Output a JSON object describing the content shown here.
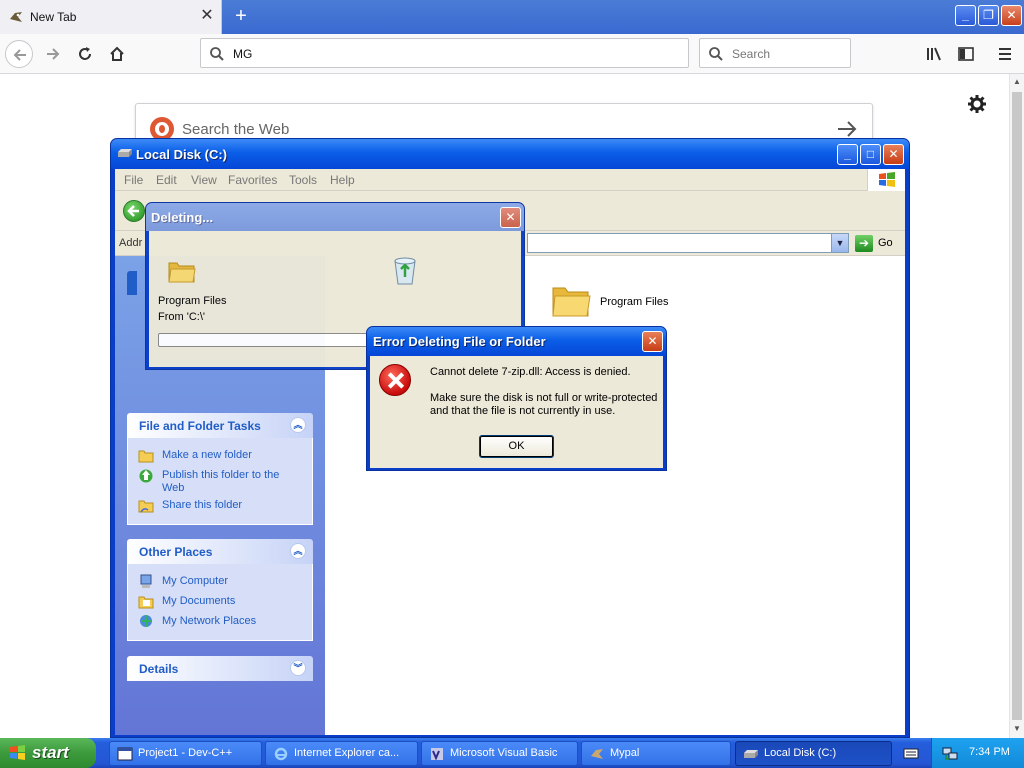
{
  "browser": {
    "tab_title": "New Tab",
    "url_value": "MG",
    "search_placeholder": "Search",
    "newtab_search_placeholder": "Search the Web"
  },
  "explorer": {
    "title": "Local Disk (C:)",
    "menu": [
      "File",
      "Edit",
      "View",
      "Favorites",
      "Tools",
      "Help"
    ],
    "address_label": "Addr",
    "go_label": "Go",
    "file_item": "Program Files",
    "file_tasks": {
      "title": "File and Folder Tasks",
      "links": [
        "Make a new folder",
        "Publish this folder to the Web",
        "Share this folder"
      ]
    },
    "other_places": {
      "title": "Other Places",
      "links": [
        "My Computer",
        "My Documents",
        "My Network Places"
      ]
    },
    "details": {
      "title": "Details"
    }
  },
  "deleting_dialog": {
    "title": "Deleting...",
    "item_name": "Program Files",
    "from_text": "From 'C:\\'"
  },
  "error_dialog": {
    "title": "Error Deleting File or Folder",
    "message": "Cannot delete 7-zip.dll: Access is denied.",
    "detail": "Make sure the disk is not full or write-protected and that the file is not currently in use.",
    "ok_label": "OK"
  },
  "taskbar": {
    "start_label": "start",
    "tasks": [
      "Project1 - Dev-C++",
      "Internet Explorer ca...",
      "Microsoft Visual Basic",
      "Mypal",
      "Local Disk (C:)"
    ],
    "clock": "7:34 PM"
  },
  "colors": {
    "xp_blue": "#0a5ee8",
    "task_link": "#215dc6",
    "start_green": "#3c9a3c",
    "error_red": "#c80c0c"
  }
}
